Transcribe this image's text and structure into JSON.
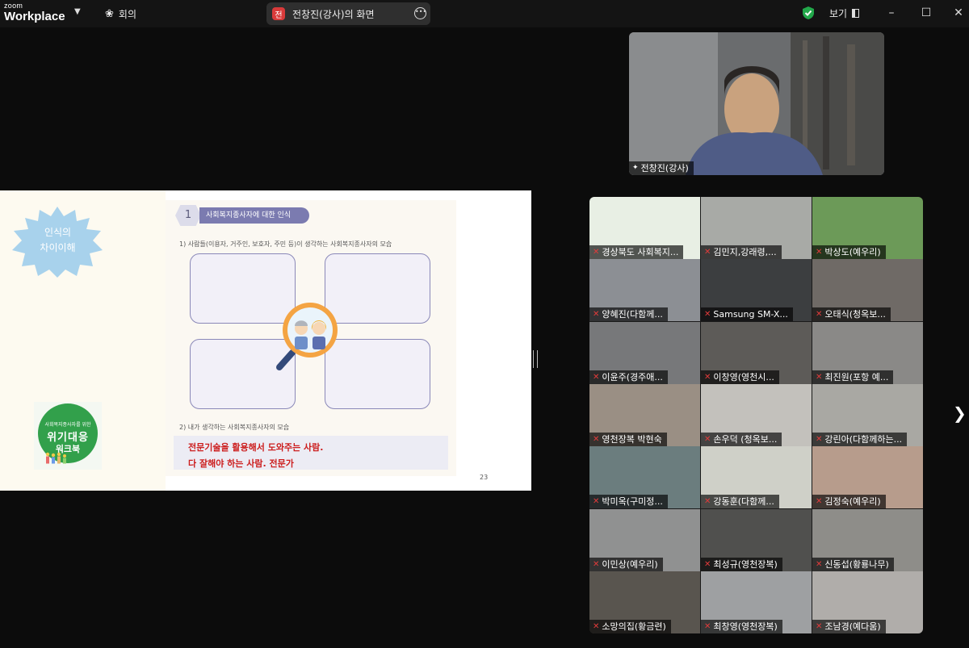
{
  "app": {
    "logo_small": "zoom",
    "logo_large": "Workplace",
    "meeting_label": "회의"
  },
  "share": {
    "badge": "전",
    "title": "전창진(강사)의 화면"
  },
  "titlebar": {
    "view_label": "보기"
  },
  "slide": {
    "star_text_line1": "인식의",
    "star_text_line2": "차이이해",
    "cover_line1": "사회복지종사자를 위한",
    "cover_line2": "위기대응",
    "cover_line3": "워크북",
    "section_number": "1",
    "section_title": "사회복지종사자에 대한 인식",
    "q1": "1) 사람들(이용자, 거주인, 보호자, 주민 등)이 생각하는 사회복지종사자의 모습",
    "q2": "2) 내가 생각하는 사회복지종사자의 모습",
    "answer_line1": "전문기술을 활용해서 도와주는 사람.",
    "answer_line2": "다 잘해야 하는 사람. 전문가",
    "page_number": "23"
  },
  "speaker": {
    "name": "전창진(강사)"
  },
  "participants": [
    {
      "name": "경상북도 사회복지...",
      "bg": "#e8efe4"
    },
    {
      "name": "김민지,강래령,...",
      "bg": "#a8aaa6"
    },
    {
      "name": "박상도(예우리)",
      "bg": "#6c9a58"
    },
    {
      "name": "양혜진(다함께...",
      "bg": "#8c8f94"
    },
    {
      "name": "Samsung SM-X...",
      "bg": "#3c3e40"
    },
    {
      "name": "오태식(청옥보...",
      "bg": "#6f6a66"
    },
    {
      "name": "이윤주(경주애...",
      "bg": "#77787a"
    },
    {
      "name": "이창영(영천시...",
      "bg": "#5d5b58"
    },
    {
      "name": "최진원(포항 예...",
      "bg": "#8a8987"
    },
    {
      "name": "영천장복 박현숙",
      "bg": "#9a8f84"
    },
    {
      "name": "손우덕 (청옥보...",
      "bg": "#c3c1bc"
    },
    {
      "name": "강린아(다함께하는...",
      "bg": "#a9a8a3"
    },
    {
      "name": "박미옥(구미정...",
      "bg": "#6b7d7e"
    },
    {
      "name": "강동훈(다함께...",
      "bg": "#cfd0c8"
    },
    {
      "name": "김정숙(예우리)",
      "bg": "#b79c8c"
    },
    {
      "name": "이민상(예우리)",
      "bg": "#909191"
    },
    {
      "name": "최성규(영천장복)",
      "bg": "#50504e"
    },
    {
      "name": "신동섭(황룡나무)",
      "bg": "#8e8d89"
    },
    {
      "name": "소망의집(황금련)",
      "bg": "#59554f"
    },
    {
      "name": "최창영(영천장복)",
      "bg": "#9ea0a2"
    },
    {
      "name": "조남경(예다움)",
      "bg": "#b0adaa"
    }
  ]
}
